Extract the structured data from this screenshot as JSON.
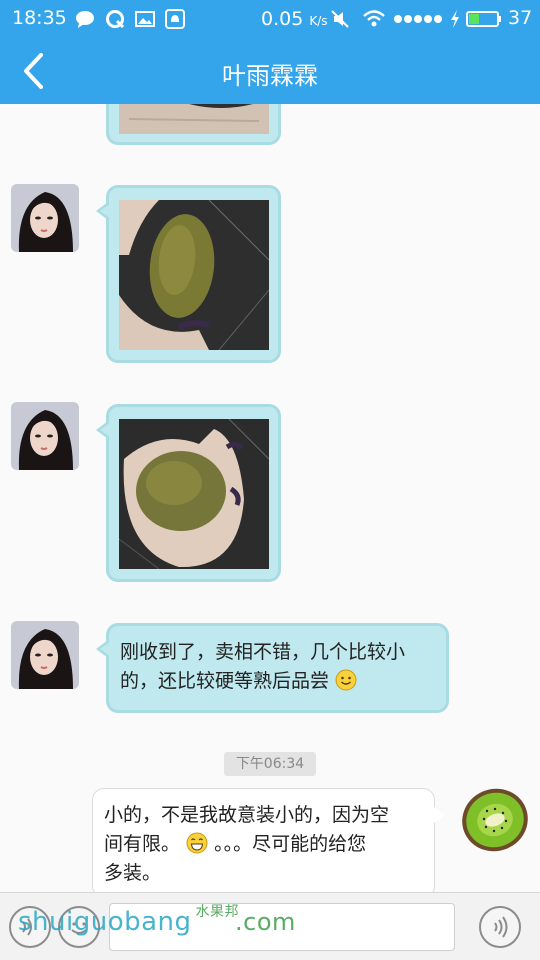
{
  "status_bar": {
    "time": "18:35",
    "network_speed": "0.05",
    "speed_unit": "K/s",
    "battery_level": "37",
    "icons": [
      "chat-bubble-icon",
      "q-app-icon",
      "image-icon",
      "notification-icon",
      "mute-icon",
      "wifi-icon",
      "signal-dots-icon",
      "charging-icon",
      "battery-icon"
    ]
  },
  "header": {
    "title": "叶雨霖霖",
    "back_icon": "chevron-left-icon"
  },
  "messages": [
    {
      "direction": "incoming",
      "kind": "photo",
      "content": "kiwi fruit held in hand (partial)"
    },
    {
      "direction": "incoming",
      "kind": "photo",
      "content": "kiwi fruit held in hand"
    },
    {
      "direction": "incoming",
      "kind": "photo",
      "content": "kiwi fruit in palm"
    },
    {
      "direction": "incoming",
      "kind": "text",
      "line1": "刚收到了，卖相不错，几个比较小",
      "line2": "的，还比较硬等熟后品尝",
      "emoji": "smile-emoji"
    },
    {
      "direction": "outgoing",
      "kind": "text",
      "line1": "小的，不是我故意装小的，因为空",
      "line2_a": "间有限。",
      "line2_b": "。。。尽可能的给您",
      "line3": "多装。",
      "emoji": "grin-emoji"
    }
  ],
  "timestamp": "下午06:34",
  "input_bar": {
    "placeholder": "",
    "left_icon": "voice-toggle-icon",
    "emoji_icon": "emoji-icon",
    "right_icon": "audio-icon"
  },
  "watermark": {
    "latin": "shuiguobang",
    "cn": "水果邦",
    "com": ".com"
  },
  "colors": {
    "header": "#34a5ea",
    "incoming_bubble": "#bfe9ee",
    "outgoing_bubble": "#ffffff"
  }
}
